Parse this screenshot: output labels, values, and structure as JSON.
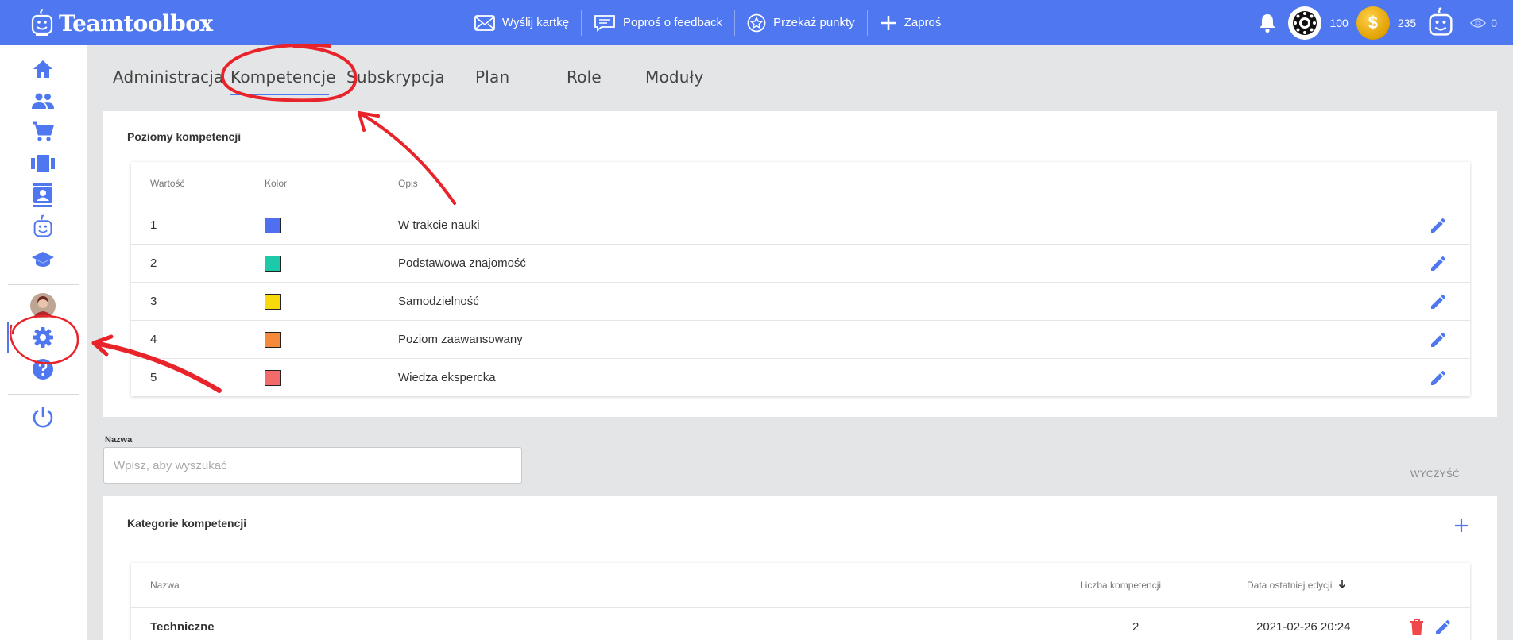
{
  "brand": {
    "name": "Teamtoolbox"
  },
  "top_actions": [
    {
      "label": "Wyślij kartkę",
      "icon": "envelope-icon"
    },
    {
      "label": "Poproś o feedback",
      "icon": "message-icon"
    },
    {
      "label": "Przekaż punkty",
      "icon": "star-circle-icon"
    },
    {
      "label": "Zaproś",
      "icon": "plus-icon"
    }
  ],
  "user_stats": {
    "points": "100",
    "coins": "235",
    "coin_symbol": "$",
    "views": "0"
  },
  "tabs": [
    {
      "label": "Administracja"
    },
    {
      "label": "Kompetencje",
      "active": true
    },
    {
      "label": "Subskrypcja"
    },
    {
      "label": "Plan"
    },
    {
      "label": "Role"
    },
    {
      "label": "Moduły"
    }
  ],
  "levels_card": {
    "title": "Poziomy kompetencji",
    "headers": {
      "value": "Wartość",
      "color": "Kolor",
      "description": "Opis"
    },
    "rows": [
      {
        "value": "1",
        "color": "#4f6ef0",
        "description": "W trakcie nauki"
      },
      {
        "value": "2",
        "color": "#1cc9a8",
        "description": "Podstawowa znajomość"
      },
      {
        "value": "3",
        "color": "#f7d90c",
        "description": "Samodzielność"
      },
      {
        "value": "4",
        "color": "#f58a3a",
        "description": "Poziom zaawansowany"
      },
      {
        "value": "5",
        "color": "#f26a6a",
        "description": "Wiedza ekspercka"
      }
    ]
  },
  "search": {
    "label": "Nazwa",
    "placeholder": "Wpisz, aby wyszukać",
    "value": "",
    "clear_label": "WYCZYŚĆ"
  },
  "categories_card": {
    "title": "Kategorie kompetencji",
    "headers": {
      "name": "Nazwa",
      "count": "Liczba kompetencji",
      "date": "Data ostatniej edycji"
    },
    "rows": [
      {
        "name": "Techniczne",
        "count": "2",
        "date": "2021-02-26 20:24"
      }
    ]
  },
  "colors": {
    "accent": "#4f78f0",
    "danger": "#f04848",
    "annotation": "#e8232a"
  }
}
